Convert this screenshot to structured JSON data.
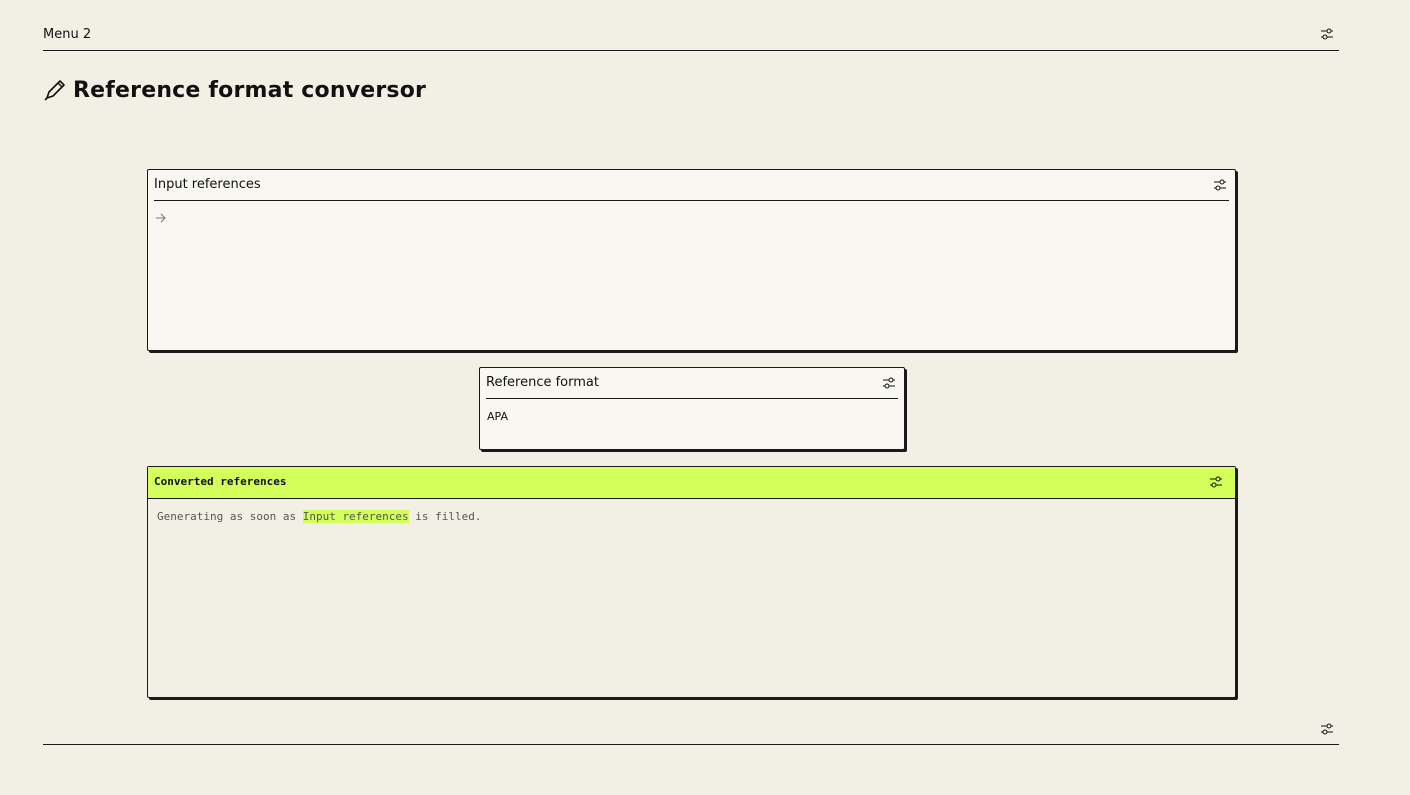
{
  "topbar": {
    "menu_label": "Menu 2",
    "settings_icon": "sliders-icon"
  },
  "page": {
    "title": "Reference format conversor",
    "title_icon": "pen-icon"
  },
  "input_panel": {
    "title": "Input references",
    "settings_icon": "sliders-icon",
    "input_icon": "arrow-right-icon"
  },
  "format_panel": {
    "title": "Reference format",
    "settings_icon": "sliders-icon",
    "selected_value": "APA"
  },
  "output_panel": {
    "title": "Converted references",
    "settings_icon": "sliders-icon",
    "placeholder_prefix": "Generating as soon as ",
    "placeholder_highlight": "Input references",
    "placeholder_suffix": " is filled.",
    "accent_color": "#d4ff5a"
  },
  "bottombar": {
    "settings_icon": "sliders-icon"
  }
}
